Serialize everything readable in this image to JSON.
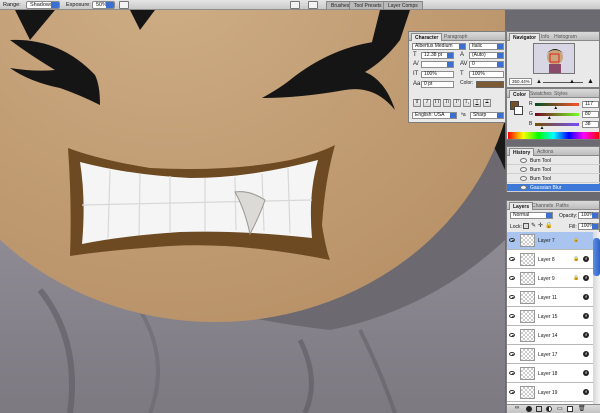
{
  "options_bar": {
    "range_label": "Range:",
    "range_value": "Shadows",
    "exposure_label": "Exposure:",
    "exposure_value": "50%",
    "well_tabs": [
      "Brushes",
      "Tool Presets",
      "Layer Comps"
    ]
  },
  "character": {
    "tabs": [
      "Character",
      "Paragraph"
    ],
    "font_family": "Albertus Medium",
    "font_style": "Italic",
    "font_size": "12.38 pt",
    "leading": "(Auto)",
    "tracking": "0",
    "vertical_scale": "100%",
    "horizontal_scale": "100%",
    "baseline_shift": "0 pt",
    "color_label": "Color:",
    "color_value": "#7b5a34",
    "format_buttons": [
      "T",
      "T",
      "TT",
      "Tt",
      "T¹",
      "T₁",
      "T",
      "T"
    ],
    "language": "English: USA",
    "aa_label": "ªa",
    "antialias": "Sharp"
  },
  "navigator": {
    "tabs": [
      "Navigator",
      "Info",
      "Histogram"
    ],
    "zoom": "350.44%"
  },
  "color": {
    "tabs": [
      "Color",
      "Swatches",
      "Styles"
    ],
    "r_label": "R",
    "r_value": "117",
    "g_label": "G",
    "g_value": "80",
    "b_label": "B",
    "b_value": "38",
    "r_fraction": 0.459,
    "g_fraction": 0.314,
    "b_fraction": 0.149,
    "foreground": "#755026"
  },
  "history": {
    "tabs": [
      "History",
      "Actions"
    ],
    "items": [
      "Burn Tool",
      "Burn Tool",
      "Burn Tool",
      "Gaussian Blur"
    ],
    "selected_index": 3
  },
  "layers": {
    "tabs": [
      "Layers",
      "Channels",
      "Paths"
    ],
    "blend_mode": "Normal",
    "opacity_label": "Opacity:",
    "opacity_value": "100%",
    "lock_label": "Lock:",
    "fill_label": "Fill:",
    "fill_value": "100%",
    "items": [
      {
        "name": "Layer 7",
        "locked": true,
        "fx": false
      },
      {
        "name": "Layer 8",
        "locked": true,
        "fx": true
      },
      {
        "name": "Layer 9",
        "locked": true,
        "fx": true
      },
      {
        "name": "Layer 11",
        "locked": false,
        "fx": true
      },
      {
        "name": "Layer 15",
        "locked": false,
        "fx": true
      },
      {
        "name": "Layer 14",
        "locked": false,
        "fx": true
      },
      {
        "name": "Layer 17",
        "locked": false,
        "fx": true
      },
      {
        "name": "Layer 18",
        "locked": false,
        "fx": true
      },
      {
        "name": "Layer 19",
        "locked": false,
        "fx": true
      }
    ],
    "selected_index": 0
  },
  "colors": {
    "skin": "#c9a57c",
    "mouth_outline": "#6e4a22",
    "hair": "#161515",
    "shirt": "#8a8890",
    "teeth": "#f7f7f7",
    "selection": "#3c79d8"
  }
}
